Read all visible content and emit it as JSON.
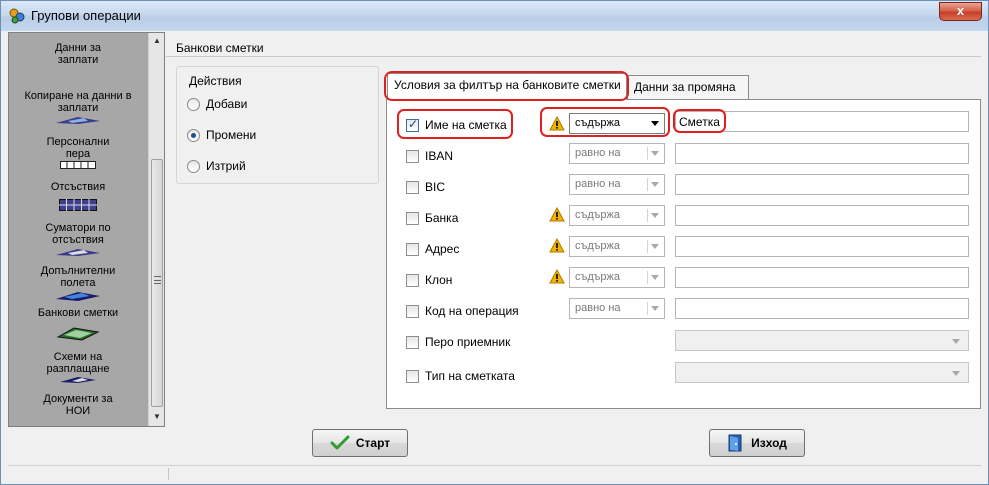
{
  "window": {
    "title": "Групови операции",
    "close_label": "x"
  },
  "nav": {
    "items": [
      {
        "label": "Данни за заплати",
        "icon": "salary-data-icon"
      },
      {
        "label": "Копиране на данни в заплати",
        "icon": "copy-data-icon"
      },
      {
        "label": "Персонални пера",
        "icon": "personal-items-icon"
      },
      {
        "label": "Отсъствия",
        "icon": "absences-icon"
      },
      {
        "label": "Суматори по отсъствия",
        "icon": "absence-summators-icon"
      },
      {
        "label": "Допълнителни полета",
        "icon": "additional-fields-icon"
      },
      {
        "label": "Банкови сметки",
        "icon": "bank-accounts-icon"
      },
      {
        "label": "Схеми на разплащане",
        "icon": "payment-schemes-icon"
      },
      {
        "label": "Документи за НОИ",
        "icon": "noi-documents-icon"
      }
    ]
  },
  "group": {
    "title": "Банкови сметки",
    "actions_title": "Действия",
    "actions": [
      {
        "label": "Добави",
        "checked": false
      },
      {
        "label": "Промени",
        "checked": true
      },
      {
        "label": "Изтрий",
        "checked": false
      }
    ]
  },
  "tabs": [
    {
      "label": "Условия за филтър на банковите сметки",
      "active": true
    },
    {
      "label": "Данни за промяна",
      "active": false
    }
  ],
  "filters": [
    {
      "label": "Име на сметка",
      "checked": true,
      "warning": true,
      "operator": "съдържа",
      "value": "Сметка"
    },
    {
      "label": "IBAN",
      "checked": false,
      "warning": false,
      "operator": "равно на",
      "value": ""
    },
    {
      "label": "BIC",
      "checked": false,
      "warning": false,
      "operator": "равно на",
      "value": ""
    },
    {
      "label": "Банка",
      "checked": false,
      "warning": true,
      "operator": "съдържа",
      "value": ""
    },
    {
      "label": "Адрес",
      "checked": false,
      "warning": true,
      "operator": "съдържа",
      "value": ""
    },
    {
      "label": "Клон",
      "checked": false,
      "warning": true,
      "operator": "съдържа",
      "value": ""
    },
    {
      "label": "Код на операция",
      "checked": false,
      "warning": false,
      "operator": "равно на",
      "value": ""
    },
    {
      "label": "Перо приемник",
      "checked": false,
      "warning": false,
      "operator": "",
      "value": ""
    },
    {
      "label": "Тип на сметката",
      "checked": false,
      "warning": false,
      "operator": "",
      "value": ""
    }
  ],
  "buttons": {
    "start": "Старт",
    "exit": "Изход"
  },
  "colors": {
    "highlight": "#e02020",
    "nav_bg": "#a7a7a7",
    "warning": "#f2b400"
  }
}
